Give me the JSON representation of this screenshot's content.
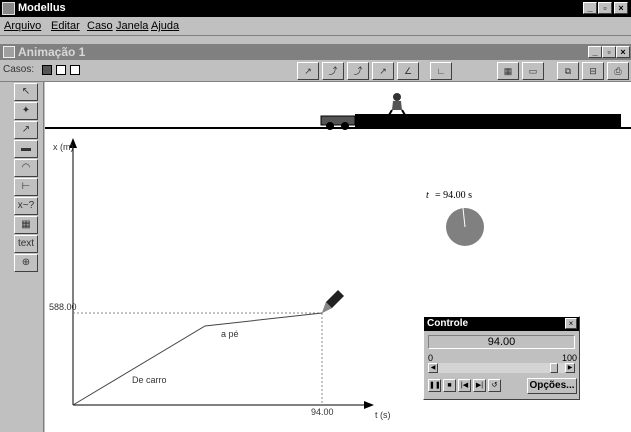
{
  "app": {
    "title": "Modellus"
  },
  "menu": [
    "Arquivo",
    "Editar",
    "Caso",
    "Janela",
    "Ajuda"
  ],
  "window": {
    "title": "Animação 1"
  },
  "toolbar": {
    "casos_label": "Casos:"
  },
  "sidebar_tools": [
    "pointer-tool",
    "particle-tool",
    "vector-tool",
    "bar-tool",
    "gauge-tool",
    "slider-tool",
    "xy-tool",
    "table-tool",
    "text-tool",
    "measure-tool"
  ],
  "sidebar_text": {
    "xy": "x~?",
    "text": "text"
  },
  "scene": {
    "car_label": "carro",
    "person_label": "pessoa"
  },
  "graph": {
    "y_axis_label": "x (m)",
    "x_axis_label": "t (s)",
    "y_marker": "588.00",
    "x_marker": "94.00",
    "segment1_label": "De carro",
    "segment2_label": "a pé"
  },
  "clock": {
    "readout_var": "t",
    "readout_value": "= 94.00  s"
  },
  "controle": {
    "title": "Controle",
    "value": "94.00",
    "min": "0",
    "max": "100",
    "progress": 0.94,
    "options_label": "Opções..."
  },
  "colors": {
    "pie_fill": "#808080",
    "title_bar": "#000000",
    "child_bar": "#808080"
  }
}
